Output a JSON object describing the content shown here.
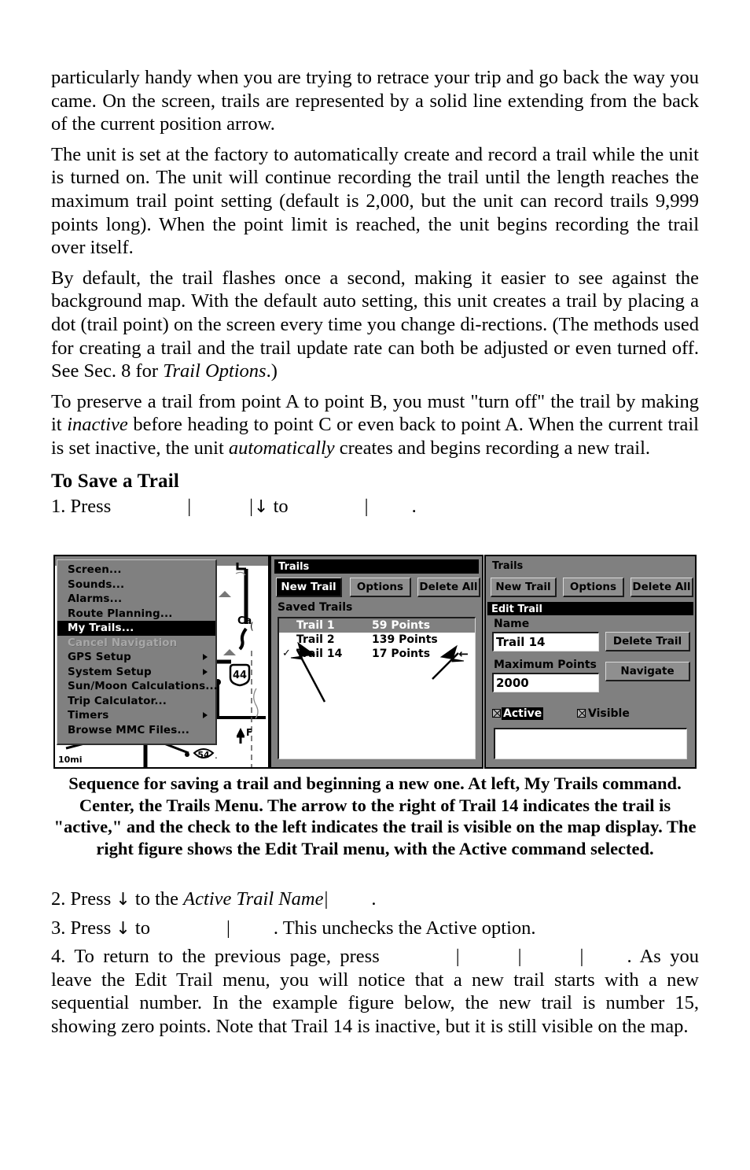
{
  "document": {
    "paragraphs": [
      "particularly handy when you are trying to retrace your trip and go back the way you came. On the screen, trails are represented by a solid line extending from the back of the current position arrow.",
      "The unit is set at the factory to automatically create and record a trail while the unit is turned on. The unit will continue recording the trail until the length reaches the maximum trail point setting (default is 2,000, but the unit can record trails 9,999 points long). When the point limit is reached, the unit begins recording the trail over itself."
    ],
    "paragraph3": {
      "before_italic": "By default, the trail flashes once a second, making it easier to see against the background map. With the default auto setting, this unit creates a trail by placing a dot (trail point) on the screen every time you change di-rections. (The methods used for creating a trail and the trail update rate can both be adjusted or even turned off. See Sec. 8 for ",
      "italic": "Trail Options",
      "after_italic": ".)"
    },
    "paragraph4": {
      "seg1": "To preserve a trail from point A to point B, you must \"turn off\" the trail by making it ",
      "ital1": "inactive",
      "seg2": " before heading to point C or even back to point A. When the current trail is set inactive, the unit ",
      "ital2": "automatically",
      "seg3": " creates and begins recording a new trail."
    },
    "section_heading": "To Save a Trail",
    "step1": {
      "prefix": "1. Press",
      "mid": "to",
      "suffix": "."
    },
    "step2": {
      "prefix": "2. Press",
      "mid": "to the",
      "italic": "Active Trail Name",
      "suffix": "."
    },
    "step3": {
      "prefix": "3. Press",
      "mid": "to",
      "suffix": ". This unchecks the Active option."
    },
    "step4": {
      "prefix": "4. To return to the previous page, press",
      "suffix": ". As you leave the Edit Trail menu, you will notice that a new trail starts with a new sequential number. In the example figure below, the new trail is number 15, showing zero points. Note that Trail 14 is inactive, but it is still visible on the map."
    },
    "caption": "Sequence for saving a trail and beginning a new one. At left, My Trails command. Center, the Trails Menu. The arrow to the right of Trail 14 indicates the trail is \"active,\" and the check to the left indicates the trail is visible on the map display. The right figure shows the Edit Trail menu, with the Active command selected.",
    "down_arrow_glyph": "↓",
    "bar_glyph": "|"
  },
  "figure_left": {
    "name": "my-trails-menu",
    "menu_items": [
      {
        "label": "Screen...",
        "state": "normal",
        "submenu": false
      },
      {
        "label": "Sounds...",
        "state": "normal",
        "submenu": false
      },
      {
        "label": "Alarms...",
        "state": "normal",
        "submenu": false
      },
      {
        "label": "Route Planning...",
        "state": "normal",
        "submenu": false
      },
      {
        "label": "My Trails...",
        "state": "selected",
        "submenu": false
      },
      {
        "label": "Cancel Navigation",
        "state": "disabled",
        "submenu": false
      },
      {
        "label": "GPS Setup",
        "state": "normal",
        "submenu": true
      },
      {
        "label": "System Setup",
        "state": "normal",
        "submenu": true
      },
      {
        "label": "Sun/Moon Calculations...",
        "state": "normal",
        "submenu": false
      },
      {
        "label": "Trip Calculator...",
        "state": "normal",
        "submenu": false
      },
      {
        "label": "Timers",
        "state": "normal",
        "submenu": true
      },
      {
        "label": "Browse MMC Files...",
        "state": "normal",
        "submenu": false
      }
    ],
    "map": {
      "scale_label": "10mi",
      "highway_shield_top": "44",
      "highway_shield_bottom": "54",
      "city_label": "Ca",
      "place_label": "F"
    }
  },
  "figure_center": {
    "name": "trails-menu",
    "title": "Trails",
    "buttons": [
      {
        "label": "New Trail",
        "selected": true
      },
      {
        "label": "Options",
        "selected": false
      },
      {
        "label": "Delete All",
        "selected": false
      }
    ],
    "list_label": "Saved Trails",
    "trails": [
      {
        "name": "Trail 1",
        "points": "59 Points",
        "highlighted": true,
        "checked": false,
        "active": false
      },
      {
        "name": "Trail 2",
        "points": "139 Points",
        "highlighted": false,
        "checked": false,
        "active": false
      },
      {
        "name": "Trail 14",
        "points": "17 Points",
        "highlighted": false,
        "checked": true,
        "active": true
      }
    ],
    "check_glyph": "✓",
    "active_arrow_glyph": "←"
  },
  "figure_right": {
    "name": "edit-trail-menu",
    "title": "Trails",
    "buttons": [
      {
        "label": "New Trail",
        "selected": false
      },
      {
        "label": "Options",
        "selected": false
      },
      {
        "label": "Delete All",
        "selected": false
      }
    ],
    "subtitle": "Edit Trail",
    "name_label": "Name",
    "name_value": "Trail 14",
    "max_points_label": "Maximum Points",
    "max_points_value": "2000",
    "delete_trail_button": "Delete Trail",
    "navigate_button": "Navigate",
    "checkboxes": [
      {
        "label": "Active",
        "checked": true,
        "selected": true
      },
      {
        "label": "Visible",
        "checked": true,
        "selected": false
      }
    ]
  },
  "colors": {
    "panel_gray": "#808080",
    "button_gray": "#8f8f8f",
    "white": "#ffffff",
    "black": "#000000",
    "disabled_gray": "#a8a8a8"
  }
}
